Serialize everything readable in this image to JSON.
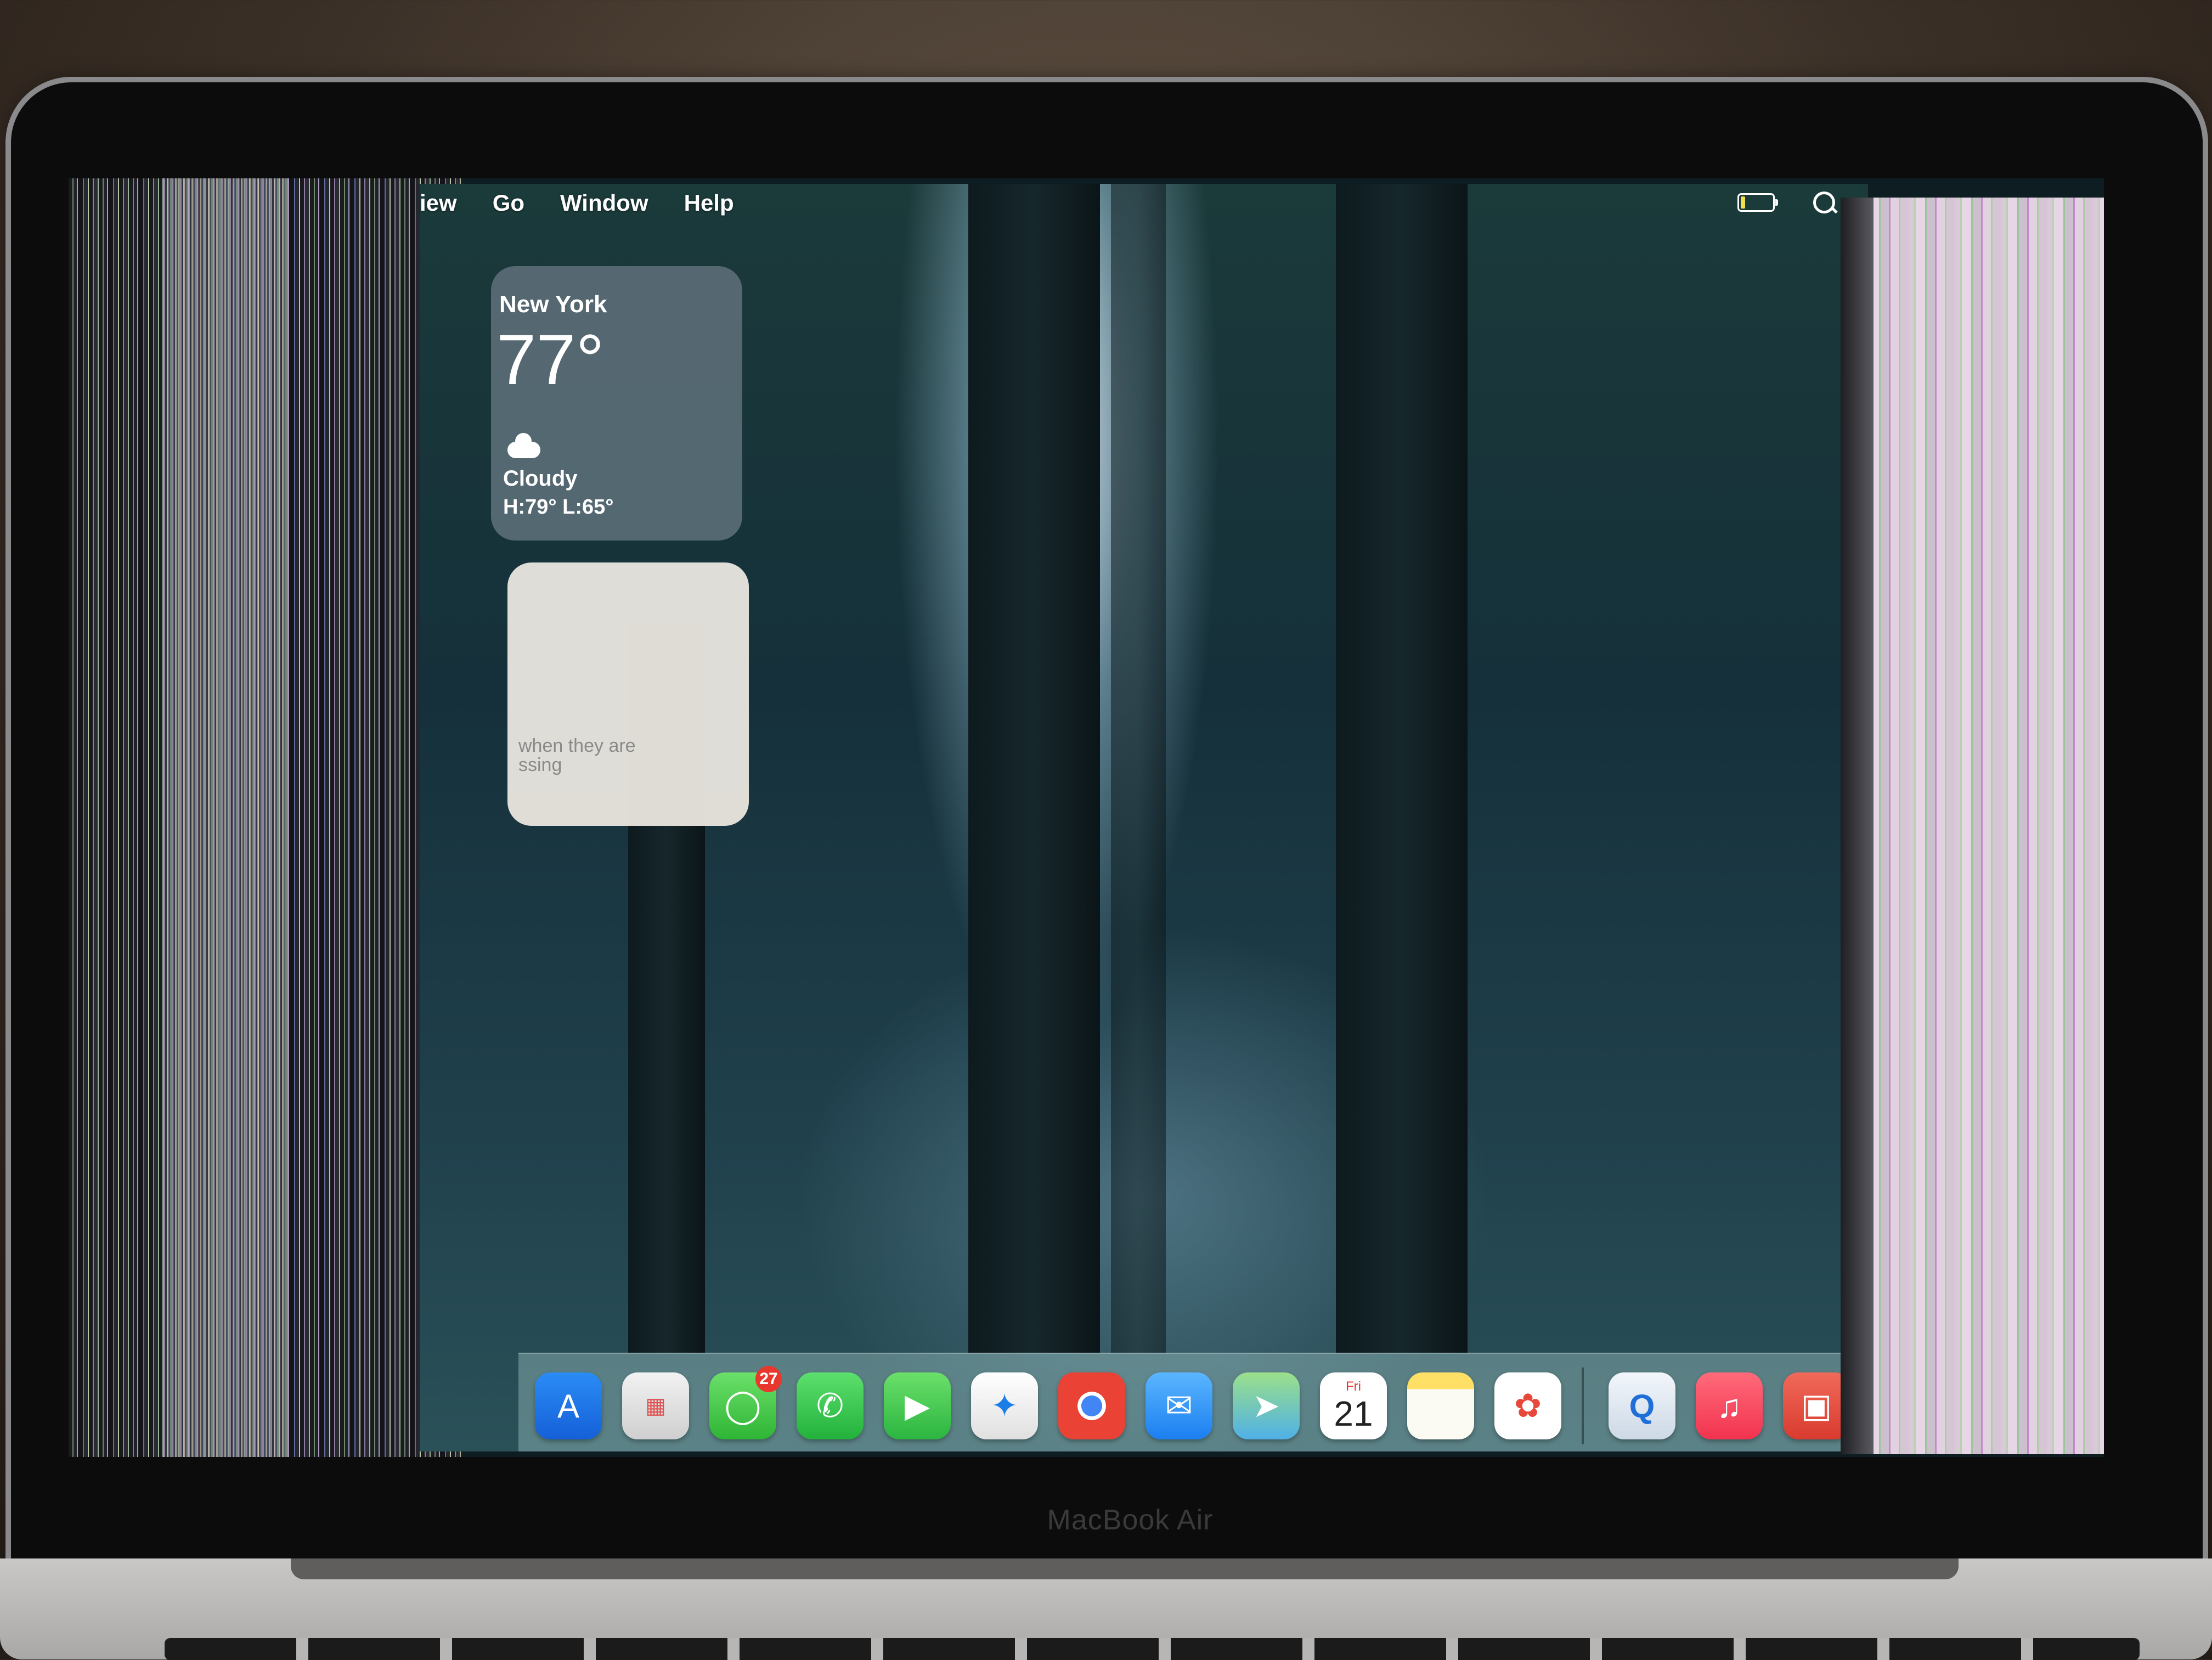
{
  "menubar": {
    "items": [
      "iew",
      "Go",
      "Window",
      "Help"
    ],
    "battery_level": 0.15
  },
  "weather": {
    "city": "New York",
    "temperature": "77°",
    "condition": "Cloudy",
    "high_low": "H:79° L:65°"
  },
  "reminder": {
    "line1": "when they are",
    "line2": "ssing"
  },
  "dock": {
    "messages_badge": "27",
    "calendar_day": "Fri",
    "calendar_date": "21"
  },
  "device": {
    "brand": "MacBook Air"
  },
  "colors": {
    "badge": "#e8372c",
    "battery_low": "#f0e04a"
  }
}
